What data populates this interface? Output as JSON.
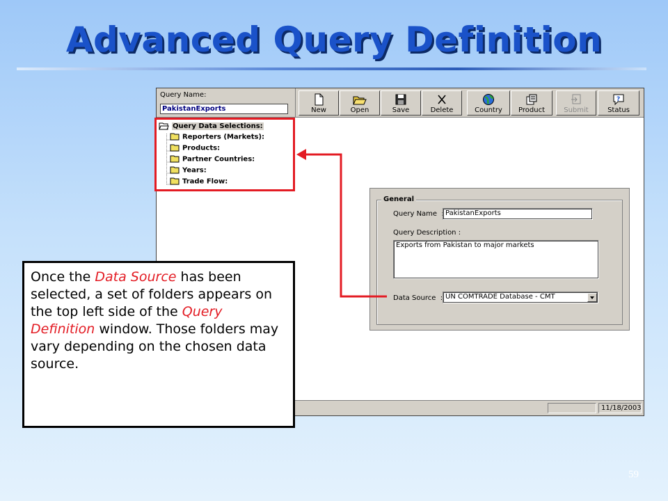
{
  "slide": {
    "title": "Advanced Query Definition",
    "page_number": "59"
  },
  "colors": {
    "title": "#1a52c9",
    "highlight_red": "#e31b23",
    "window_gray": "#d4d0c8"
  },
  "app": {
    "query_name_label": "Query Name:",
    "query_name_value": "PakistanExports",
    "toolbar": [
      {
        "label": "New",
        "icon": "new-document-icon",
        "enabled": true
      },
      {
        "label": "Open",
        "icon": "open-folder-icon",
        "enabled": true
      },
      {
        "label": "Save",
        "icon": "save-disk-icon",
        "enabled": true
      },
      {
        "label": "Delete",
        "icon": "delete-x-icon",
        "enabled": true
      },
      {
        "label": "Country",
        "icon": "globe-icon",
        "enabled": true
      },
      {
        "label": "Product",
        "icon": "product-icon",
        "enabled": true
      },
      {
        "label": "Submit",
        "icon": "submit-icon",
        "enabled": false
      },
      {
        "label": "Status",
        "icon": "help-status-icon",
        "enabled": true
      }
    ],
    "tree": {
      "root": "Query Data Selections:",
      "items": [
        "Reporters (Markets):",
        "Products:",
        "Partner Countries:",
        "Years:",
        "Trade Flow:"
      ]
    },
    "general": {
      "legend": "General",
      "query_name_label": "Query Name",
      "query_name_value": "PakistanExports",
      "query_description_label": "Query Description :",
      "query_description_value": "Exports from Pakistan to major markets",
      "data_source_label": "Data Source",
      "data_source_value": "UN COMTRADE Database - CMT"
    },
    "status_date": "11/18/2003"
  },
  "callout": {
    "part1": "Once the ",
    "hl1": "Data Source",
    "part2": " has been selected, a set of folders appears on the top left side of the ",
    "hl2": "Query Definition",
    "part3": " window. Those folders may vary depending on the chosen data source."
  }
}
